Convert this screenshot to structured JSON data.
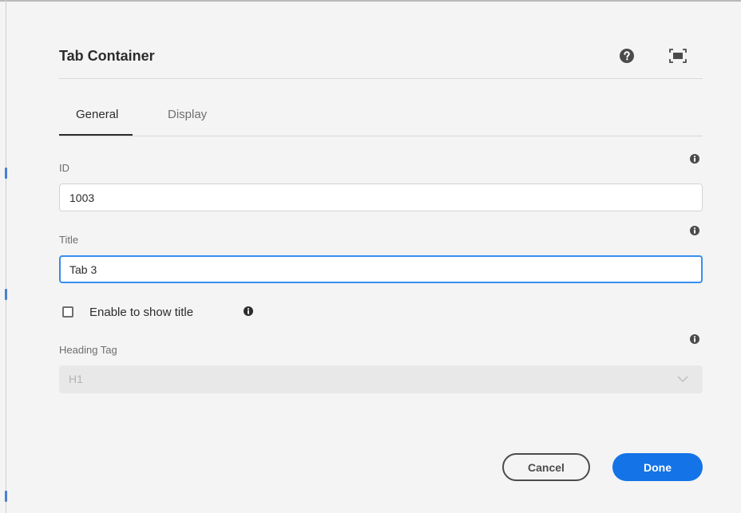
{
  "dialog": {
    "title": "Tab Container",
    "header_icons": [
      "help-icon",
      "fullscreen-icon"
    ]
  },
  "tabs": [
    {
      "label": "General",
      "selected": true
    },
    {
      "label": "Display",
      "selected": false
    }
  ],
  "form": {
    "id_field": {
      "label": "ID",
      "value": "1003"
    },
    "title_field": {
      "label": "Title",
      "value": "Tab 3"
    },
    "show_title": {
      "label": "Enable to show title",
      "checked": false
    },
    "heading_tag": {
      "label": "Heading Tag",
      "value": "H1",
      "disabled": true
    }
  },
  "buttons": {
    "cancel": "Cancel",
    "done": "Done"
  },
  "colors": {
    "accent": "#1473e6",
    "focus_ring": "#378ef0",
    "background": "#f4f4f4"
  }
}
